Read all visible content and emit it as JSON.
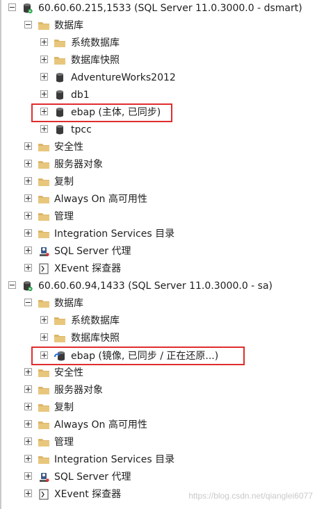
{
  "servers": [
    {
      "name": "60.60.60.215,1533 (SQL Server 11.0.3000.0 - dsmart)",
      "databases_folder": "数据库",
      "db_items": [
        {
          "label": "系统数据库",
          "icon": "folder-icon"
        },
        {
          "label": "数据库快照",
          "icon": "folder-icon"
        },
        {
          "label": "AdventureWorks2012",
          "icon": "database-icon"
        },
        {
          "label": "db1",
          "icon": "database-icon"
        },
        {
          "label": "ebap (主体, 已同步)",
          "icon": "database-icon"
        },
        {
          "label": "tpcc",
          "icon": "database-icon"
        }
      ],
      "folders": [
        {
          "label": "安全性",
          "icon": "folder-icon"
        },
        {
          "label": "服务器对象",
          "icon": "folder-icon"
        },
        {
          "label": "复制",
          "icon": "folder-icon"
        },
        {
          "label": "Always On 高可用性",
          "icon": "folder-icon"
        },
        {
          "label": "管理",
          "icon": "folder-icon"
        },
        {
          "label": "Integration Services 目录",
          "icon": "folder-icon"
        },
        {
          "label": "SQL Server 代理",
          "icon": "sql-agent-icon"
        },
        {
          "label": "XEvent 探查器",
          "icon": "xevent-icon"
        }
      ]
    },
    {
      "name": "60.60.60.94,1433 (SQL Server 11.0.3000.0 - sa)",
      "databases_folder": "数据库",
      "db_items": [
        {
          "label": "系统数据库",
          "icon": "folder-icon"
        },
        {
          "label": "数据库快照",
          "icon": "folder-icon"
        },
        {
          "label": "ebap (镜像, 已同步 / 正在还原...)",
          "icon": "mirror-database-icon"
        }
      ],
      "folders": [
        {
          "label": "安全性",
          "icon": "folder-icon"
        },
        {
          "label": "服务器对象",
          "icon": "folder-icon"
        },
        {
          "label": "复制",
          "icon": "folder-icon"
        },
        {
          "label": "Always On 高可用性",
          "icon": "folder-icon"
        },
        {
          "label": "管理",
          "icon": "folder-icon"
        },
        {
          "label": "Integration Services 目录",
          "icon": "folder-icon"
        },
        {
          "label": "SQL Server 代理",
          "icon": "sql-agent-icon"
        },
        {
          "label": "XEvent 探查器",
          "icon": "xevent-icon"
        }
      ]
    }
  ],
  "watermark": "https://blog.csdn.net/qianglei6077",
  "colors": {
    "highlight": "#e02c2c",
    "folder": "#dcb567",
    "database": "#3a3a3a"
  }
}
